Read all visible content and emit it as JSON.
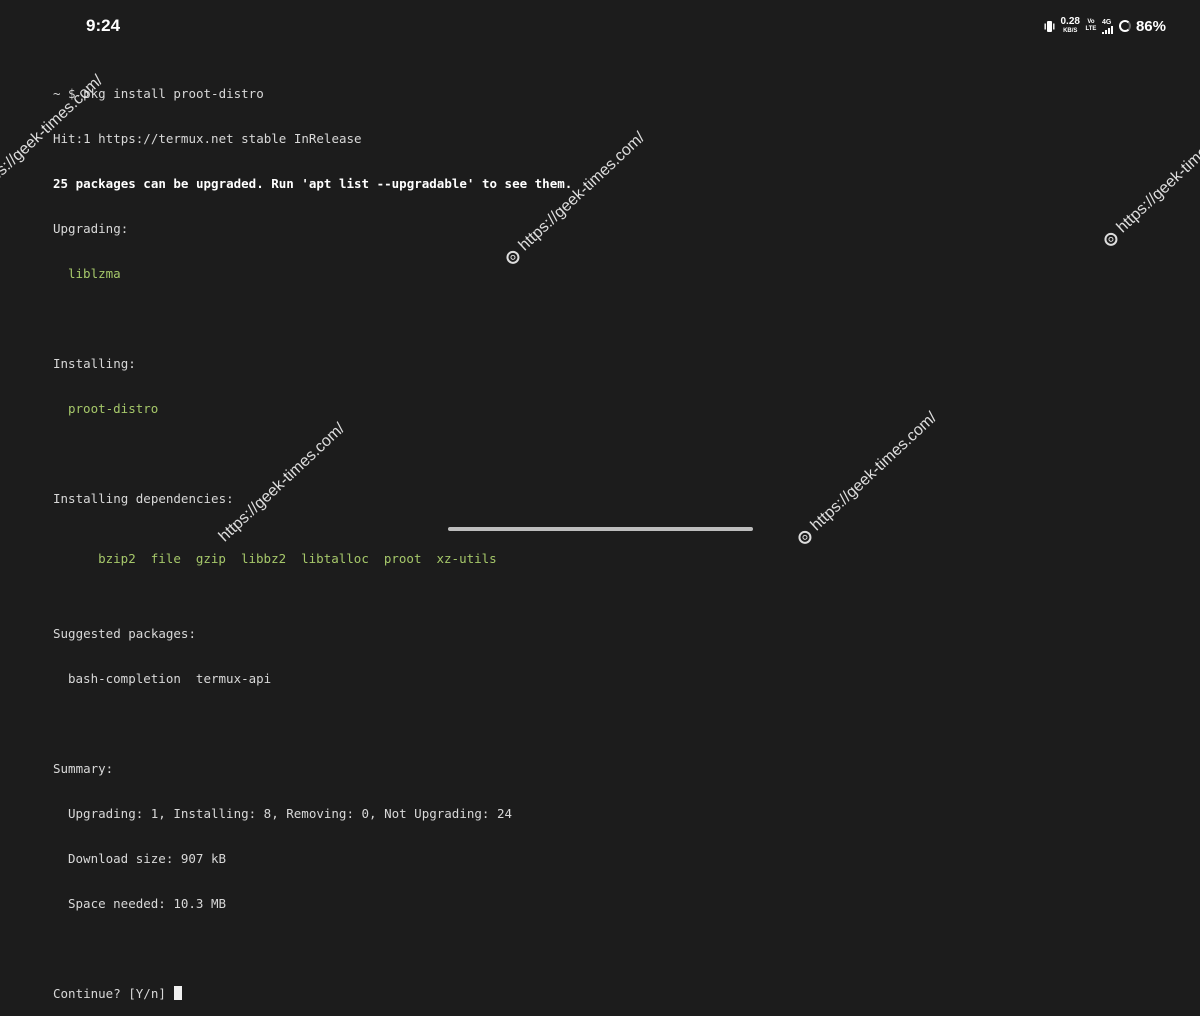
{
  "status_bar": {
    "time": "9:24",
    "net_speed_value": "0.28",
    "net_speed_unit": "KB/S",
    "volte_top": "Vo",
    "volte_bottom": "LTE",
    "network": "4G",
    "battery": "86%",
    "icons": [
      "vibrate-icon",
      "signal-icon",
      "battery-ring-icon"
    ]
  },
  "terminal": {
    "prompt": "~ $ pkg install proot-distro",
    "hit": "Hit:1 https://termux.net stable InRelease",
    "upgrade_notice": "25 packages can be upgraded. Run 'apt list --upgradable' to see them.",
    "upgrading_label": "Upgrading:",
    "upgrading_pkg": "liblzma",
    "installing_label": "Installing:",
    "installing_pkg": "proot-distro",
    "deps_label": "Installing dependencies:",
    "deps": [
      "bzip2",
      "file",
      "gzip",
      "libbz2",
      "libtalloc",
      "proot",
      "xz-utils"
    ],
    "suggested_label": "Suggested packages:",
    "suggested": "bash-completion  termux-api",
    "summary_label": "Summary:",
    "summary_counts": "Upgrading: 1, Installing: 8, Removing: 0, Not Upgrading: 24",
    "download_size": "Download size: 907 kB",
    "space_needed": "Space needed: 10.3 MB",
    "continue_prompt": "Continue? [Y/n]"
  },
  "watermark": {
    "text": "https://geek-times.com/"
  },
  "colors": {
    "background": "#1c1c1c",
    "text": "#d8d8d8",
    "package_green": "#a6c86a"
  }
}
